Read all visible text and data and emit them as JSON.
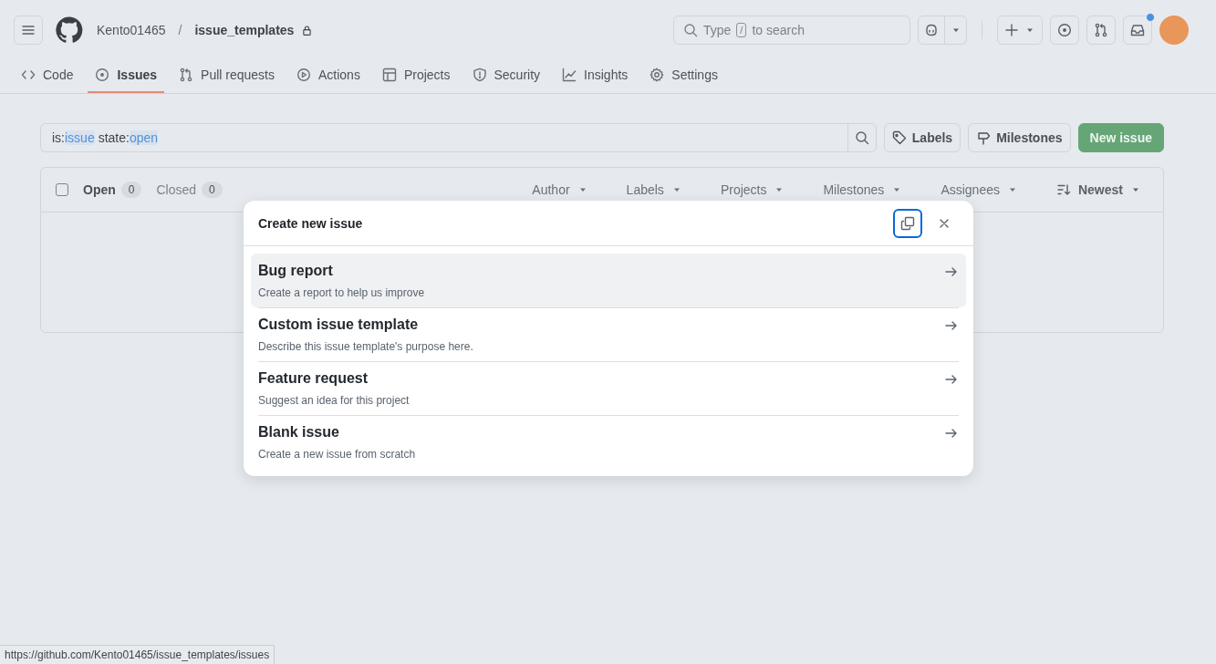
{
  "header": {
    "owner": "Kento01465",
    "separator": "/",
    "repo": "issue_templates",
    "private": true,
    "search_before": "Type",
    "search_key": "/",
    "search_after": "to search",
    "inbox_unread": true
  },
  "tabs": [
    {
      "label": "Code",
      "selected": false
    },
    {
      "label": "Issues",
      "selected": true
    },
    {
      "label": "Pull requests",
      "selected": false
    },
    {
      "label": "Actions",
      "selected": false
    },
    {
      "label": "Projects",
      "selected": false
    },
    {
      "label": "Security",
      "selected": false
    },
    {
      "label": "Insights",
      "selected": false
    },
    {
      "label": "Settings",
      "selected": false
    }
  ],
  "filter": {
    "tokens": [
      {
        "key": "is:",
        "value": "issue"
      },
      {
        "key": "state:",
        "value": "open"
      }
    ]
  },
  "actions": {
    "labels": "Labels",
    "milestones": "Milestones",
    "new_issue": "New issue"
  },
  "issues": {
    "select_all_checked": false,
    "states": [
      {
        "label": "Open",
        "count": "0",
        "selected": true
      },
      {
        "label": "Closed",
        "count": "0",
        "selected": false
      }
    ],
    "filters": [
      {
        "label": "Author",
        "kind": "menu"
      },
      {
        "label": "Labels",
        "kind": "menu"
      },
      {
        "label": "Projects",
        "kind": "menu"
      },
      {
        "label": "Milestones",
        "kind": "menu"
      },
      {
        "label": "Assignees",
        "kind": "menu"
      },
      {
        "label": "Newest",
        "kind": "sort"
      }
    ]
  },
  "dialog": {
    "title": "Create new issue",
    "templates": [
      {
        "name": "Bug report",
        "description": "Create a report to help us improve",
        "selected": true
      },
      {
        "name": "Custom issue template",
        "description": "Describe this issue template's purpose here.",
        "selected": false
      },
      {
        "name": "Feature request",
        "description": "Suggest an idea for this project",
        "selected": false
      },
      {
        "name": "Blank issue",
        "description": "Create a new issue from scratch",
        "selected": false
      }
    ]
  },
  "status_bar": {
    "url": "https://github.com/Kento01465/issue_templates/issues"
  }
}
